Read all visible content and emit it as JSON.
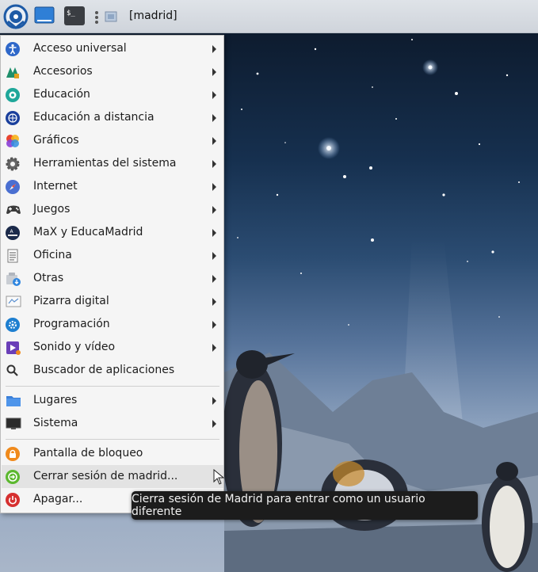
{
  "panel": {
    "workspace_label": "[madrid]",
    "launchers": [
      {
        "icon": "madrid-menu-icon"
      },
      {
        "icon": "show-desktop-icon"
      },
      {
        "icon": "terminal-icon"
      },
      {
        "icon": "window-list-icon"
      }
    ]
  },
  "menu": {
    "categories": [
      {
        "label": "Acceso universal",
        "icon": "accessibility-icon",
        "submenu": true
      },
      {
        "label": "Accesorios",
        "icon": "accessories-icon",
        "submenu": true
      },
      {
        "label": "Educación",
        "icon": "education-icon",
        "submenu": true
      },
      {
        "label": "Educación a distancia",
        "icon": "distance-education-icon",
        "submenu": true
      },
      {
        "label": "Gráficos",
        "icon": "graphics-icon",
        "submenu": true
      },
      {
        "label": "Herramientas del sistema",
        "icon": "system-tools-icon",
        "submenu": true
      },
      {
        "label": "Internet",
        "icon": "internet-icon",
        "submenu": true
      },
      {
        "label": "Juegos",
        "icon": "games-icon",
        "submenu": true
      },
      {
        "label": "MaX y EducaMadrid",
        "icon": "max-educamadrid-icon",
        "submenu": true
      },
      {
        "label": "Oficina",
        "icon": "office-icon",
        "submenu": true
      },
      {
        "label": "Otras",
        "icon": "other-icon",
        "submenu": true
      },
      {
        "label": "Pizarra digital",
        "icon": "digital-whiteboard-icon",
        "submenu": true
      },
      {
        "label": "Programación",
        "icon": "programming-icon",
        "submenu": true
      },
      {
        "label": "Sonido y vídeo",
        "icon": "sound-video-icon",
        "submenu": true
      },
      {
        "label": "Buscador de aplicaciones",
        "icon": "search-icon",
        "submenu": false
      }
    ],
    "places": [
      {
        "label": "Lugares",
        "icon": "folder-icon",
        "submenu": true
      },
      {
        "label": "Sistema",
        "icon": "monitor-icon",
        "submenu": true
      }
    ],
    "session": [
      {
        "label": "Pantalla de bloqueo",
        "icon": "lock-icon"
      },
      {
        "label": "Cerrar sesión de madrid...",
        "icon": "logout-icon",
        "highlighted": true
      },
      {
        "label": "Apagar...",
        "icon": "power-icon"
      }
    ]
  },
  "tooltip": {
    "text": "Cierra sesión de Madrid para entrar como un usuario diferente"
  },
  "colors": {
    "panel": "#d8dce2",
    "menu_bg": "#f5f5f5",
    "hover": "#e3e3e3",
    "tooltip_bg": "#1c1c1c"
  }
}
